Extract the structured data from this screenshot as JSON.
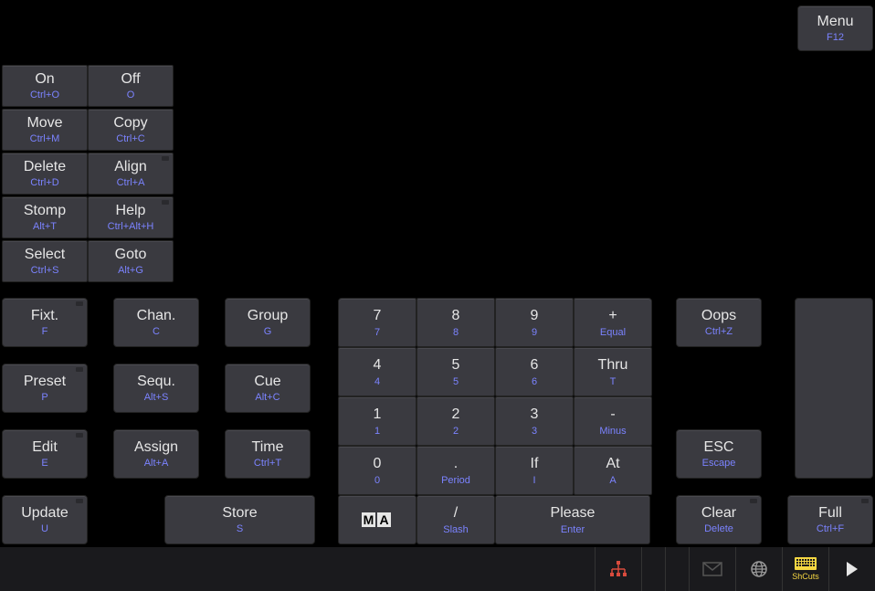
{
  "menu": {
    "label": "Menu",
    "shortcut": "F12"
  },
  "leftGrid": [
    {
      "name": "on-button",
      "label": "On",
      "shortcut": "Ctrl+O",
      "hasDot": false
    },
    {
      "name": "off-button",
      "label": "Off",
      "shortcut": "O",
      "hasDot": false
    },
    {
      "name": "move-button",
      "label": "Move",
      "shortcut": "Ctrl+M",
      "hasDot": false
    },
    {
      "name": "copy-button",
      "label": "Copy",
      "shortcut": "Ctrl+C",
      "hasDot": false
    },
    {
      "name": "delete-button",
      "label": "Delete",
      "shortcut": "Ctrl+D",
      "hasDot": false
    },
    {
      "name": "align-button",
      "label": "Align",
      "shortcut": "Ctrl+A",
      "hasDot": true
    },
    {
      "name": "stomp-button",
      "label": "Stomp",
      "shortcut": "Alt+T",
      "hasDot": false
    },
    {
      "name": "help-button",
      "label": "Help",
      "shortcut": "Ctrl+Alt+H",
      "hasDot": true
    },
    {
      "name": "select-button",
      "label": "Select",
      "shortcut": "Ctrl+S",
      "hasDot": false
    },
    {
      "name": "goto-button",
      "label": "Goto",
      "shortcut": "Alt+G",
      "hasDot": false
    }
  ],
  "midGrid": [
    {
      "name": "fixt-button",
      "label": "Fixt.",
      "shortcut": "F",
      "hasDot": true
    },
    {
      "name": "chan-button",
      "label": "Chan.",
      "shortcut": "C",
      "hasDot": false
    },
    {
      "name": "group-button",
      "label": "Group",
      "shortcut": "G",
      "hasDot": false
    },
    {
      "name": "preset-button",
      "label": "Preset",
      "shortcut": "P",
      "hasDot": true
    },
    {
      "name": "sequ-button",
      "label": "Sequ.",
      "shortcut": "Alt+S",
      "hasDot": false
    },
    {
      "name": "cue-button",
      "label": "Cue",
      "shortcut": "Alt+C",
      "hasDot": false
    },
    {
      "name": "edit-button",
      "label": "Edit",
      "shortcut": "E",
      "hasDot": true
    },
    {
      "name": "assign-button",
      "label": "Assign",
      "shortcut": "Alt+A",
      "hasDot": false
    },
    {
      "name": "time-button",
      "label": "Time",
      "shortcut": "Ctrl+T",
      "hasDot": false
    }
  ],
  "update": {
    "label": "Update",
    "shortcut": "U"
  },
  "store": {
    "label": "Store",
    "shortcut": "S"
  },
  "numpad": [
    [
      {
        "name": "num-7",
        "label": "7",
        "shortcut": "7"
      },
      {
        "name": "num-8",
        "label": "8",
        "shortcut": "8"
      },
      {
        "name": "num-9",
        "label": "9",
        "shortcut": "9"
      },
      {
        "name": "num-plus",
        "label": "+",
        "shortcut": "Equal"
      }
    ],
    [
      {
        "name": "num-4",
        "label": "4",
        "shortcut": "4"
      },
      {
        "name": "num-5",
        "label": "5",
        "shortcut": "5"
      },
      {
        "name": "num-6",
        "label": "6",
        "shortcut": "6"
      },
      {
        "name": "num-thru",
        "label": "Thru",
        "shortcut": "T"
      }
    ],
    [
      {
        "name": "num-1",
        "label": "1",
        "shortcut": "1"
      },
      {
        "name": "num-2",
        "label": "2",
        "shortcut": "2"
      },
      {
        "name": "num-3",
        "label": "3",
        "shortcut": "3"
      },
      {
        "name": "num-minus",
        "label": "-",
        "shortcut": "Minus"
      }
    ],
    [
      {
        "name": "num-0",
        "label": "0",
        "shortcut": "0"
      },
      {
        "name": "num-period",
        "label": ".",
        "shortcut": "Period"
      },
      {
        "name": "num-if",
        "label": "If",
        "shortcut": "I"
      },
      {
        "name": "num-at",
        "label": "At",
        "shortcut": "A"
      }
    ]
  ],
  "numpadBottom": {
    "ma": {
      "name": "ma-button"
    },
    "slash": {
      "name": "num-slash",
      "label": "/",
      "shortcut": "Slash"
    },
    "please": {
      "name": "please-button",
      "label": "Please",
      "shortcut": "Enter"
    }
  },
  "rightCol": {
    "oops": {
      "label": "Oops",
      "shortcut": "Ctrl+Z"
    },
    "esc": {
      "label": "ESC",
      "shortcut": "Escape"
    },
    "clear": {
      "label": "Clear",
      "shortcut": "Delete"
    },
    "full": {
      "label": "Full",
      "shortcut": "Ctrl+F"
    }
  },
  "bottomBar": {
    "shcuts": {
      "label": "ShCuts"
    }
  }
}
